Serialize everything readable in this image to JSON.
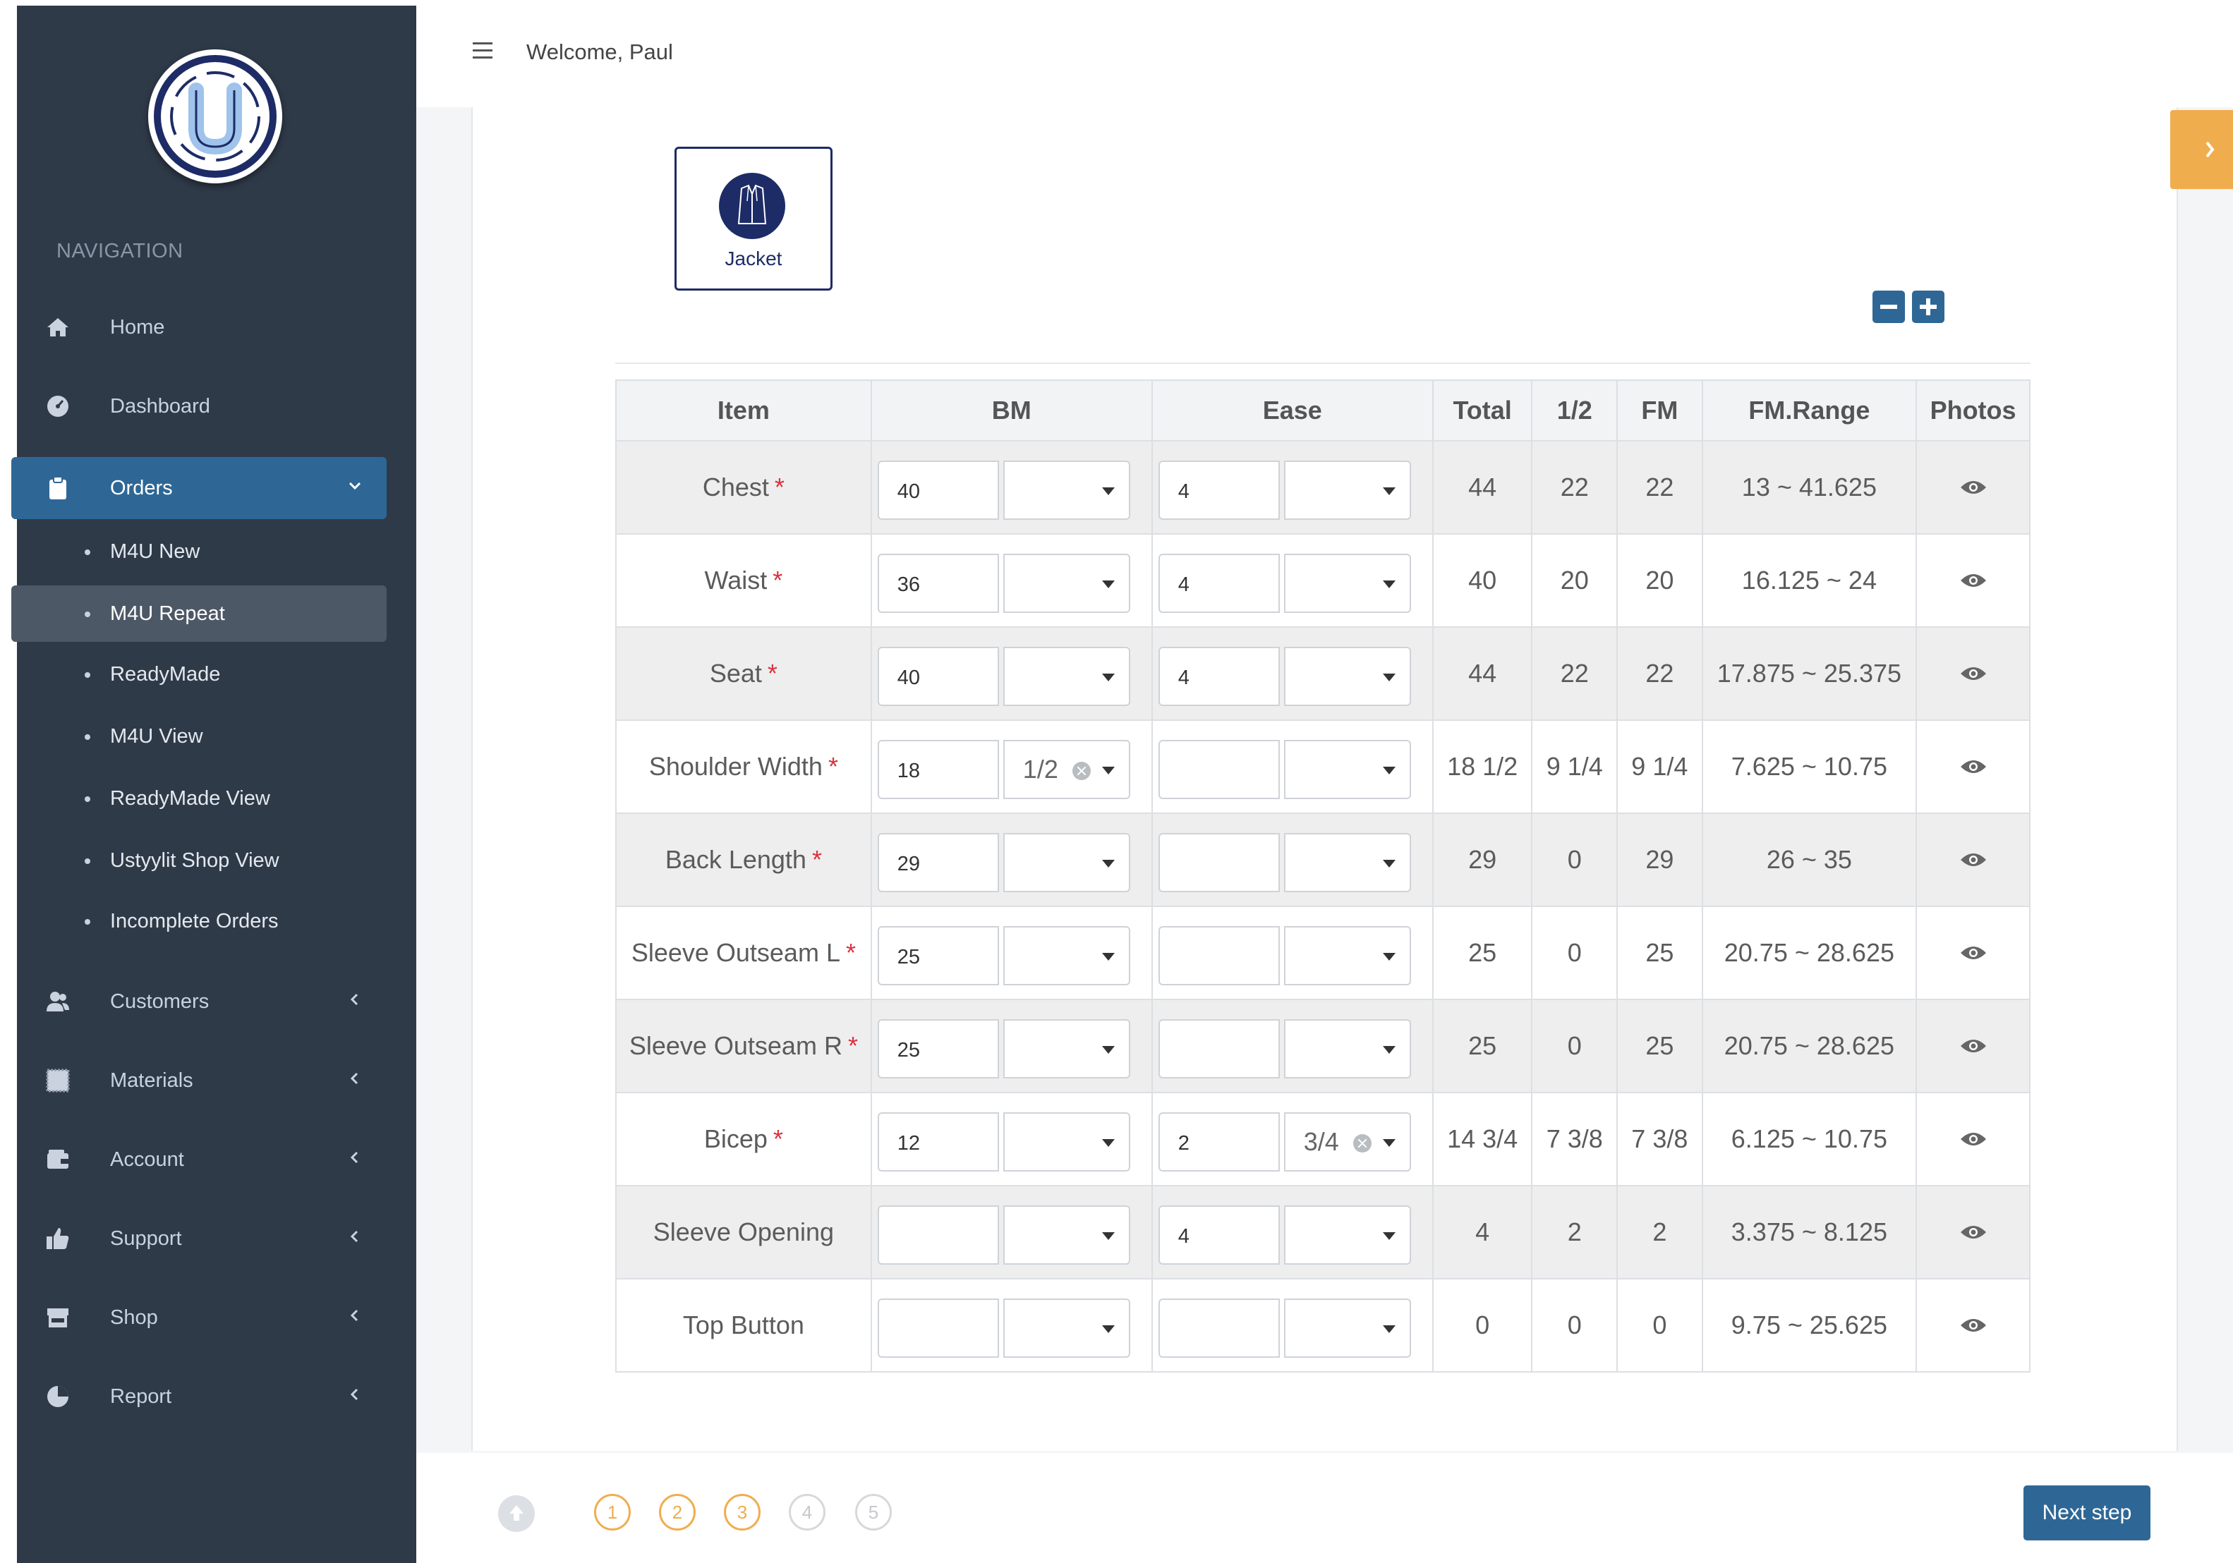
{
  "header": {
    "welcome": "Welcome, Paul"
  },
  "sidebar": {
    "heading": "NAVIGATION",
    "items": [
      {
        "label": "Home",
        "icon": "home-icon"
      },
      {
        "label": "Dashboard",
        "icon": "dashboard-icon"
      },
      {
        "label": "Orders",
        "icon": "clipboard-icon",
        "active": true,
        "expanded": true
      },
      {
        "label": "Customers",
        "icon": "users-icon"
      },
      {
        "label": "Materials",
        "icon": "fabric-icon"
      },
      {
        "label": "Account",
        "icon": "wallet-icon"
      },
      {
        "label": "Support",
        "icon": "thumbs-up-icon"
      },
      {
        "label": "Shop",
        "icon": "shop-icon"
      },
      {
        "label": "Report",
        "icon": "pie-chart-icon"
      }
    ],
    "orders_sub": [
      {
        "label": "M4U New"
      },
      {
        "label": "M4U Repeat",
        "active": true
      },
      {
        "label": "ReadyMade"
      },
      {
        "label": "M4U View"
      },
      {
        "label": "ReadyMade View"
      },
      {
        "label": "Ustyylit Shop View"
      },
      {
        "label": "Incomplete Orders"
      }
    ]
  },
  "garment": {
    "label": "Jacket"
  },
  "table": {
    "headers": [
      "Item",
      "BM",
      "Ease",
      "Total",
      "1/2",
      "FM",
      "FM.Range",
      "Photos"
    ],
    "rows": [
      {
        "item": "Chest",
        "required": true,
        "bm": "40",
        "bm_frac": "",
        "ease": "4",
        "ease_frac": "",
        "total": "44",
        "half": "22",
        "fm": "22",
        "range": "13 ~ 41.625"
      },
      {
        "item": "Waist",
        "required": true,
        "bm": "36",
        "bm_frac": "",
        "ease": "4",
        "ease_frac": "",
        "total": "40",
        "half": "20",
        "fm": "20",
        "range": "16.125 ~ 24"
      },
      {
        "item": "Seat",
        "required": true,
        "bm": "40",
        "bm_frac": "",
        "ease": "4",
        "ease_frac": "",
        "total": "44",
        "half": "22",
        "fm": "22",
        "range": "17.875 ~ 25.375"
      },
      {
        "item": "Shoulder Width",
        "required": true,
        "bm": "18",
        "bm_frac": "1/2",
        "ease": "",
        "ease_frac": "",
        "total": "18 1/2",
        "half": "9 1/4",
        "fm": "9 1/4",
        "range": "7.625 ~ 10.75"
      },
      {
        "item": "Back Length",
        "required": true,
        "bm": "29",
        "bm_frac": "",
        "ease": "",
        "ease_frac": "",
        "total": "29",
        "half": "0",
        "fm": "29",
        "range": "26 ~ 35"
      },
      {
        "item": "Sleeve Outseam L",
        "required": true,
        "bm": "25",
        "bm_frac": "",
        "ease": "",
        "ease_frac": "",
        "total": "25",
        "half": "0",
        "fm": "25",
        "range": "20.75 ~ 28.625"
      },
      {
        "item": "Sleeve Outseam R",
        "required": true,
        "bm": "25",
        "bm_frac": "",
        "ease": "",
        "ease_frac": "",
        "total": "25",
        "half": "0",
        "fm": "25",
        "range": "20.75 ~ 28.625"
      },
      {
        "item": "Bicep",
        "required": true,
        "bm": "12",
        "bm_frac": "",
        "ease": "2",
        "ease_frac": "3/4",
        "total": "14 3/4",
        "half": "7 3/8",
        "fm": "7 3/8",
        "range": "6.125 ~ 10.75"
      },
      {
        "item": "Sleeve Opening",
        "required": false,
        "bm": "",
        "bm_frac": "",
        "ease": "4",
        "ease_frac": "",
        "total": "4",
        "half": "2",
        "fm": "2",
        "range": "3.375 ~ 8.125"
      },
      {
        "item": "Top Button",
        "required": false,
        "bm": "",
        "bm_frac": "",
        "ease": "",
        "ease_frac": "",
        "total": "0",
        "half": "0",
        "fm": "0",
        "range": "9.75 ~ 25.625"
      }
    ]
  },
  "steps": {
    "items": [
      "1",
      "2",
      "3",
      "4",
      "5"
    ],
    "completed_through": 3
  },
  "footer": {
    "next_label": "Next step"
  },
  "colors": {
    "sidebar_bg": "#2f3a49",
    "active_nav": "#2e6795",
    "accent_orange": "#f0ad4e",
    "required_star": "#d9333f",
    "brand_navy": "#1d2c66"
  }
}
